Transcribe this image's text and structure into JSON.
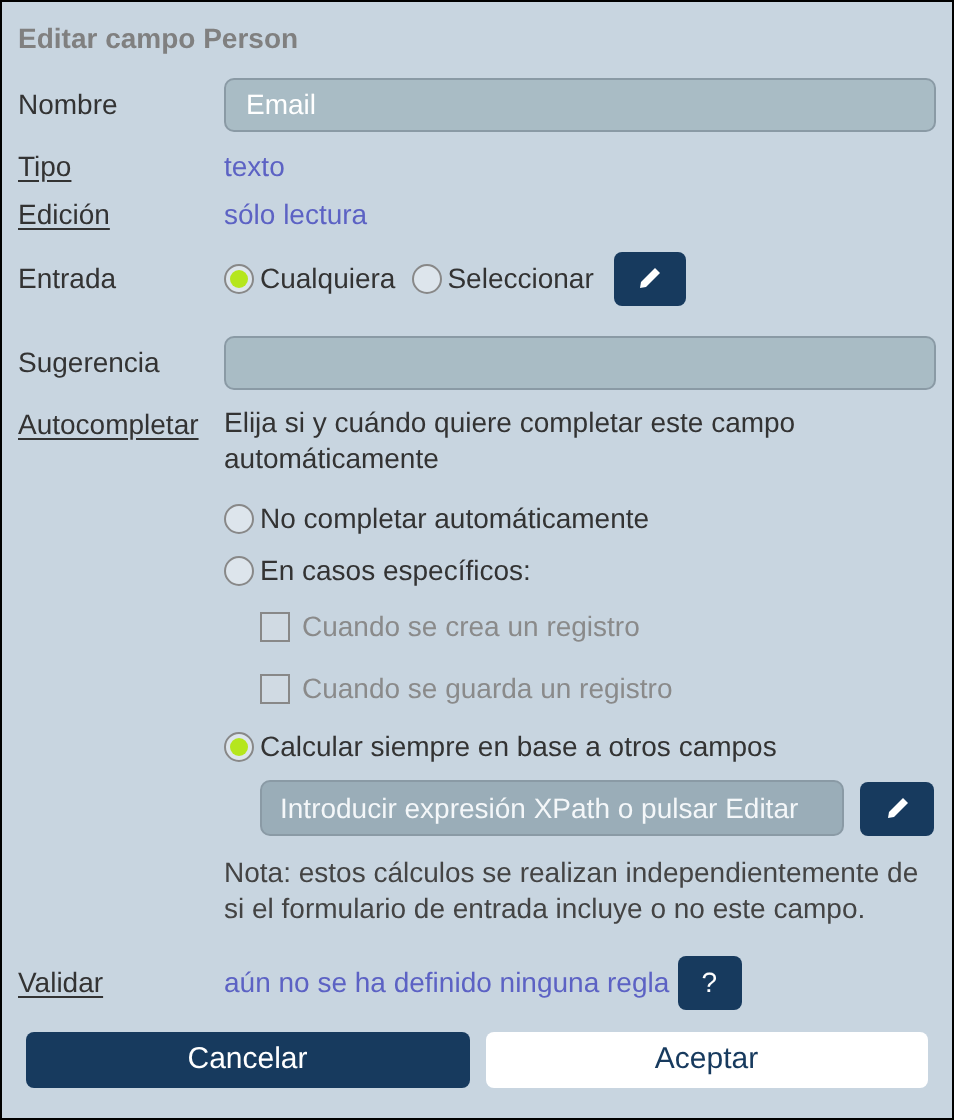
{
  "title": "Editar campo Person",
  "nombre": {
    "label": "Nombre",
    "link": false,
    "value": "Email"
  },
  "tipo": {
    "label": "Tipo",
    "link": true,
    "value": "texto"
  },
  "edicion": {
    "label": "Edición",
    "link": true,
    "value": "sólo lectura"
  },
  "entrada": {
    "label": "Entrada",
    "link": false,
    "options": [
      {
        "label": "Cualquiera",
        "selected": true
      },
      {
        "label": "Seleccionar",
        "selected": false
      }
    ]
  },
  "sugerencia": {
    "label": "Sugerencia",
    "link": false
  },
  "autocompletar": {
    "label": "Autocompletar",
    "link": true,
    "description": "Elija si y cuándo quiere completar este campo automáticamente",
    "options": [
      {
        "kind": "radio",
        "label": "No completar automáticamente",
        "selected": false
      },
      {
        "kind": "radio",
        "label": "En casos específicos:",
        "selected": false
      },
      {
        "kind": "checkbox",
        "label": "Cuando se crea un registro",
        "checked": false,
        "disabled": true
      },
      {
        "kind": "checkbox",
        "label": "Cuando se guarda un registro",
        "checked": false,
        "disabled": true
      },
      {
        "kind": "radio",
        "label": "Calcular siempre en base a otros campos",
        "selected": true
      }
    ],
    "xpath": {
      "placeholder": "Introducir expresión XPath o pulsar Editar"
    },
    "note": "Nota: estos cálculos se realizan independientemente de si el formulario de entrada incluye o no este campo."
  },
  "validar": {
    "label": "Validar",
    "link": true,
    "value": "aún no se ha definido ninguna regla",
    "help": "?"
  },
  "buttons": [
    {
      "label": "Cancelar",
      "kind": "primary"
    },
    {
      "label": "Aceptar",
      "kind": "secondary"
    }
  ]
}
